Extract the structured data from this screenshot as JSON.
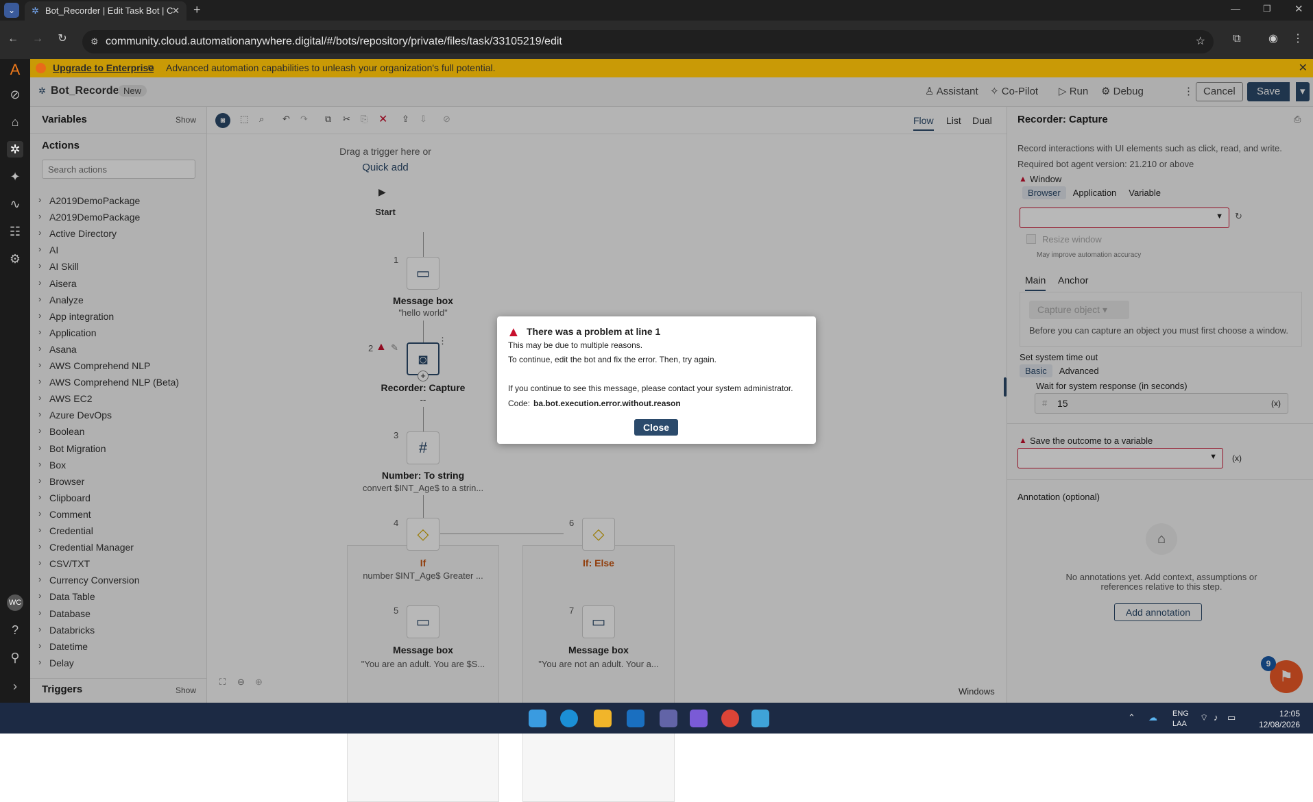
{
  "browser": {
    "tab_title": "Bot_Recorder | Edit Task Bot | C",
    "url": "community.cloud.automationanywhere.digital/#/bots/repository/private/files/task/33105219/edit"
  },
  "banner": {
    "link": "Upgrade to Enterprise",
    "text": "Advanced automation capabilities to unleash your organization's full potential."
  },
  "header": {
    "bot_name": "Bot_Recorder",
    "badge": "New",
    "assistant": "Assistant",
    "copilot": "Co-Pilot",
    "run": "Run",
    "debug": "Debug",
    "cancel": "Cancel",
    "save": "Save"
  },
  "left": {
    "variables": "Variables",
    "show": "Show",
    "actions": "Actions",
    "search_placeholder": "Search actions",
    "triggers": "Triggers",
    "triggers_show": "Show",
    "items": [
      "A2019DemoPackage",
      "A2019DemoPackage",
      "Active Directory",
      "AI",
      "AI Skill",
      "Aisera",
      "Analyze",
      "App integration",
      "Application",
      "Asana",
      "AWS Comprehend NLP",
      "AWS Comprehend NLP (Beta)",
      "AWS EC2",
      "Azure DevOps",
      "Boolean",
      "Bot Migration",
      "Box",
      "Browser",
      "Clipboard",
      "Comment",
      "Credential",
      "Credential Manager",
      "CSV/TXT",
      "Currency Conversion",
      "Data Table",
      "Database",
      "Databricks",
      "Datetime",
      "Delay"
    ]
  },
  "canvas": {
    "views": [
      "Flow",
      "List",
      "Dual"
    ],
    "drag_hint": "Drag a trigger here or",
    "quick_add": "Quick add",
    "start": "Start",
    "windows": "Windows",
    "nodes": {
      "n1": {
        "num": "1",
        "title": "Message box",
        "sub": "\"hello world\""
      },
      "n2": {
        "num": "2",
        "title": "Recorder: Capture",
        "sub": "--"
      },
      "n3": {
        "num": "3",
        "title": "Number: To string",
        "sub": "convert $INT_Age$ to a strin..."
      },
      "n4": {
        "num": "4",
        "title": "If",
        "sub": "number $INT_Age$ Greater ..."
      },
      "n5": {
        "num": "5",
        "title": "Message box",
        "sub": "\"You are an adult. You are $S..."
      },
      "n6": {
        "num": "6",
        "title": "If: Else"
      },
      "n7": {
        "num": "7",
        "title": "Message box",
        "sub": "\"You are not an adult. Your a..."
      }
    }
  },
  "right": {
    "title": "Recorder: Capture",
    "desc": "Record interactions with UI elements such as click, read, and write.",
    "required": "Required bot agent version: 21.210 or above",
    "window_label": "Window",
    "window_tabs": [
      "Browser",
      "Application",
      "Variable"
    ],
    "resize": "Resize window",
    "resize_hint": "May improve automation accuracy",
    "tabs": [
      "Main",
      "Anchor"
    ],
    "capture": "Capture object",
    "capture_hint": "Before you can capture an object you must first choose a window.",
    "timeout_label": "Set system time out",
    "timeout_tabs": [
      "Basic",
      "Advanced"
    ],
    "wait_label": "Wait for system response (in seconds)",
    "wait_value": "15",
    "var_icon": "(x)",
    "outcome_label": "Save the outcome to a variable",
    "annotation": "Annotation (optional)",
    "no_annotations": "No annotations yet. Add context, assumptions or references relative to this step.",
    "add_annotation": "Add annotation",
    "help_badge": "9"
  },
  "modal": {
    "title": "There was a problem at line 1",
    "line1": "This may be due to multiple reasons.",
    "line2": "To continue, edit the bot and fix the error. Then, try again.",
    "line3": "If you continue to see this message, please contact your system administrator.",
    "code_label": "Code:",
    "code": "ba.bot.execution.error.without.reason",
    "close": "Close"
  },
  "taskbar": {
    "lang": "ENG",
    "layout": "LAA",
    "time": "12:05",
    "date": "12/08/2026"
  },
  "user": {
    "initials": "WC"
  },
  "colors": {
    "banner": "#c99a06",
    "accent": "#2b4a6b",
    "error": "#c8102e",
    "if_yellow": "#d4a900"
  }
}
